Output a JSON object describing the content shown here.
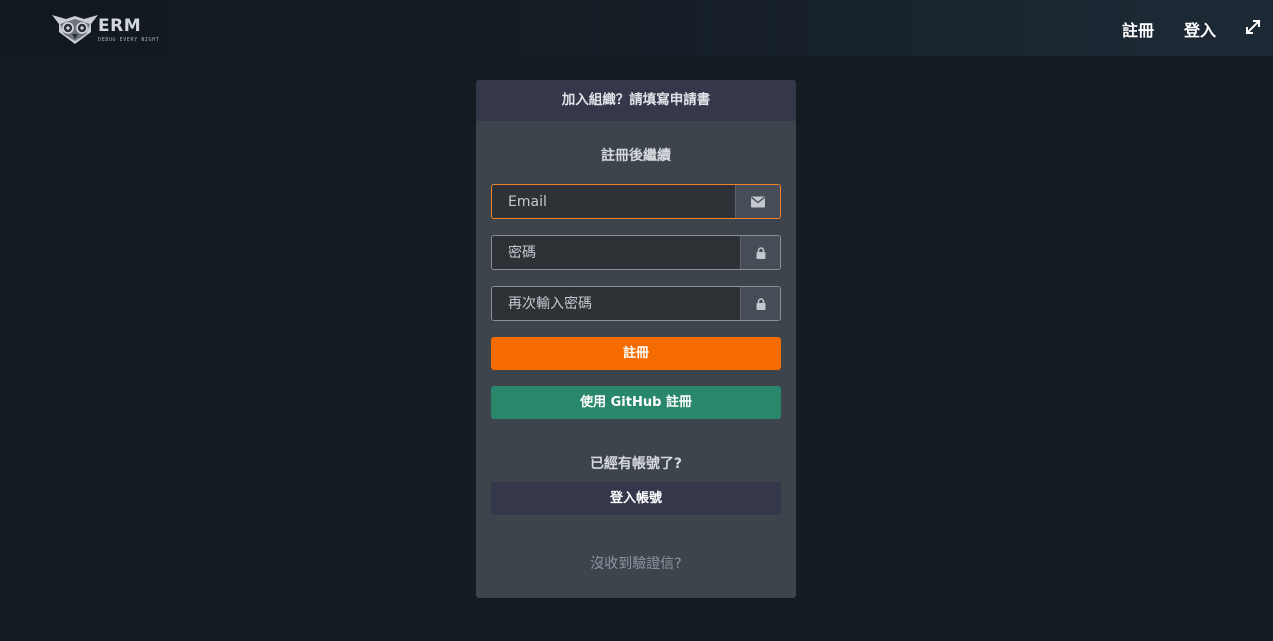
{
  "brand": {
    "name": "ERM",
    "tagline": "DEBUG EVERY NIGHT"
  },
  "nav": {
    "register_label": "註冊",
    "login_label": "登入",
    "expand_icon": "expand-icon"
  },
  "card": {
    "header": "加入組織？請填寫申請書",
    "subtitle": "註冊後繼續",
    "fields": {
      "email": {
        "value": "",
        "placeholder": "Email",
        "icon": "envelope-icon"
      },
      "password": {
        "value": "",
        "placeholder": "密碼",
        "icon": "lock-icon"
      },
      "confirm_password": {
        "value": "",
        "placeholder": "再次輸入密碼",
        "icon": "lock-icon"
      }
    },
    "register_button": "註冊",
    "github_button": "使用 GitHub 註冊",
    "has_account_text": "已經有帳號了?",
    "login_button": "登入帳號",
    "resend_link": "沒收到驗證信?"
  },
  "colors": {
    "accent": "#f56b00",
    "github": "#29876b",
    "focus_border": "#f0832a",
    "background": "#151b22",
    "card": "#3d444c",
    "card_header": "#35374a"
  }
}
